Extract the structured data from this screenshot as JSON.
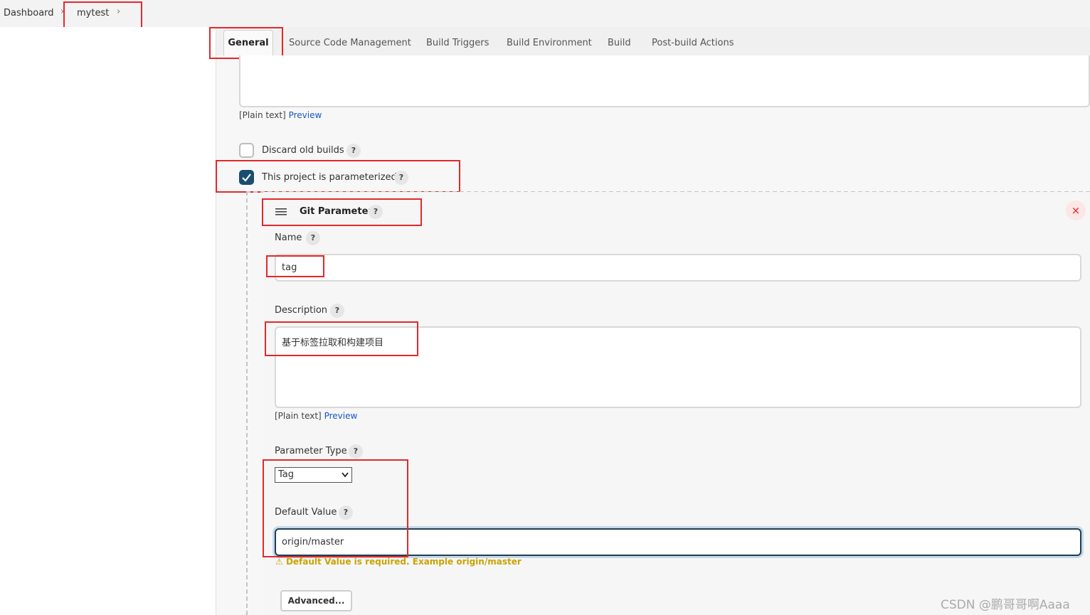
{
  "breadcrumb": {
    "items": [
      "Dashboard",
      "mytest"
    ]
  },
  "tabs": [
    "General",
    "Source Code Management",
    "Build Triggers",
    "Build Environment",
    "Build",
    "Post-build Actions"
  ],
  "top_description": {
    "format_text": "[Plain text]",
    "preview_label": "Preview"
  },
  "options": {
    "discard_old_builds": "Discard old builds",
    "parameterized": "This project is parameterized"
  },
  "param": {
    "title": "Git Parameter",
    "name_label": "Name",
    "name_value": "tag",
    "description_label": "Description",
    "description_value": "基于标签拉取和构建项目",
    "description_format": "[Plain text]",
    "description_preview": "Preview",
    "type_label": "Parameter Type",
    "type_value": "Tag",
    "default_label": "Default Value",
    "default_value": "origin/master",
    "warning": "Default Value is required. Example origin/master",
    "advanced_button": "Advanced..."
  },
  "help_glyph": "?",
  "close_glyph": "×",
  "warning_glyph": "⚠",
  "watermark": "CSDN @鹏哥哥啊Aaaa",
  "colors": {
    "accent": "#1757c4",
    "checkbox_checked": "#1a4d6e",
    "annotation_red": "#e4282b",
    "warning": "#c9a400"
  }
}
